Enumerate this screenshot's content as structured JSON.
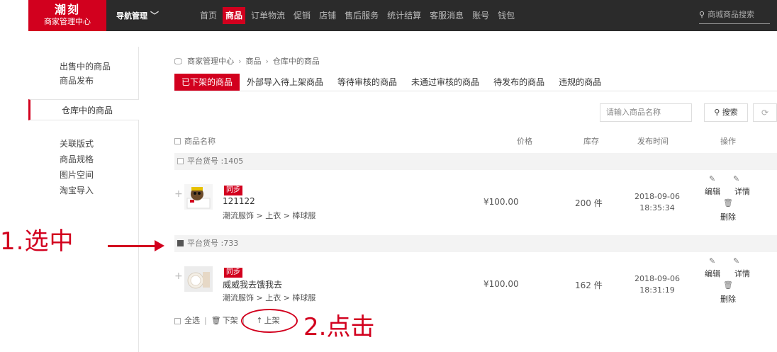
{
  "header": {
    "logo_line1": "潮刻",
    "logo_line2": "商家管理中心",
    "nav_manager": "导航管理",
    "menu": [
      "首页",
      "商品",
      "订单物流",
      "促销",
      "店铺",
      "售后服务",
      "统计结算",
      "客服消息",
      "账号",
      "钱包"
    ],
    "active_menu": "商品",
    "search_placeholder": "商城商品搜索"
  },
  "sidebar": {
    "group1": [
      "出售中的商品",
      "商品发布"
    ],
    "active": "仓库中的商品",
    "group2": [
      "关联版式",
      "商品规格",
      "图片空间",
      "淘宝导入"
    ]
  },
  "breadcrumb": [
    "商家管理中心",
    "商品",
    "仓库中的商品"
  ],
  "tabs": [
    "已下架的商品",
    "外部导入待上架商品",
    "等待审核的商品",
    "未通过审核的商品",
    "待发布的商品",
    "违规的商品"
  ],
  "filter": {
    "placeholder": "请输入商品名称",
    "search_label": "搜索"
  },
  "table": {
    "headers": {
      "name": "商品名称",
      "price": "价格",
      "stock": "库存",
      "time": "发布时间",
      "ops": "操作"
    },
    "groups": [
      {
        "label": "平台货号 :1405",
        "checked": false,
        "item": {
          "badge": "同步",
          "name": "121122",
          "category": "潮流服饰 > 上衣 > 棒球服",
          "price": "¥100.00",
          "stock": "200 件",
          "date": "2018-09-06",
          "time": "18:35:34"
        }
      },
      {
        "label": "平台货号 :733",
        "checked": true,
        "item": {
          "badge": "同步",
          "name": "威威我去饿我去",
          "category": "潮流服饰 > 上衣 > 棒球服",
          "price": "¥100.00",
          "stock": "162 件",
          "date": "2018-09-06",
          "time": "18:31:19"
        }
      }
    ],
    "ops": {
      "edit": "编辑",
      "detail": "详情",
      "delete": "删除"
    }
  },
  "bottom": {
    "select_all": "全选",
    "unshelve": "下架",
    "shelve": "上架"
  },
  "annotations": {
    "step1": "1.选中",
    "step2": "2.点击"
  },
  "colors": {
    "accent": "#d2001e",
    "topbar": "#2b2b2b"
  }
}
